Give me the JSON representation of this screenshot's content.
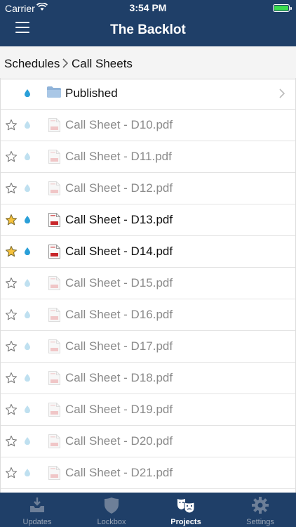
{
  "status_bar": {
    "carrier": "Carrier",
    "time": "3:54 PM",
    "battery_color": "#3bdc4f"
  },
  "header": {
    "title": "The Backlot",
    "menu_icon": "hamburger-icon",
    "bg_color": "#1f3f68"
  },
  "breadcrumb": {
    "parent": "Schedules",
    "current": "Call Sheets"
  },
  "list": [
    {
      "type": "folder",
      "name": "Published",
      "starred": false,
      "active": true
    },
    {
      "type": "pdf",
      "name": "Call Sheet - D10.pdf",
      "starred": false,
      "active": false
    },
    {
      "type": "pdf",
      "name": "Call Sheet - D11.pdf",
      "starred": false,
      "active": false
    },
    {
      "type": "pdf",
      "name": "Call Sheet - D12.pdf",
      "starred": false,
      "active": false
    },
    {
      "type": "pdf",
      "name": "Call Sheet - D13.pdf",
      "starred": true,
      "active": true
    },
    {
      "type": "pdf",
      "name": "Call Sheet - D14.pdf",
      "starred": true,
      "active": true
    },
    {
      "type": "pdf",
      "name": "Call Sheet - D15.pdf",
      "starred": false,
      "active": false
    },
    {
      "type": "pdf",
      "name": "Call Sheet - D16.pdf",
      "starred": false,
      "active": false
    },
    {
      "type": "pdf",
      "name": "Call Sheet - D17.pdf",
      "starred": false,
      "active": false
    },
    {
      "type": "pdf",
      "name": "Call Sheet - D18.pdf",
      "starred": false,
      "active": false
    },
    {
      "type": "pdf",
      "name": "Call Sheet - D19.pdf",
      "starred": false,
      "active": false
    },
    {
      "type": "pdf",
      "name": "Call Sheet - D20.pdf",
      "starred": false,
      "active": false
    },
    {
      "type": "pdf",
      "name": "Call Sheet - D21.pdf",
      "starred": false,
      "active": false
    },
    {
      "type": "pdf",
      "name": "",
      "starred": false,
      "active": false
    }
  ],
  "tabs": [
    {
      "label": "Updates",
      "icon": "inbox-download-icon",
      "active": false
    },
    {
      "label": "Lockbox",
      "icon": "shield-icon",
      "active": false
    },
    {
      "label": "Projects",
      "icon": "theater-masks-icon",
      "active": true
    },
    {
      "label": "Settings",
      "icon": "gear-icon",
      "active": false
    }
  ],
  "colors": {
    "star_active": "#f6c23c",
    "drop": "#2a9fd8",
    "pdf_red": "#c8262a"
  }
}
